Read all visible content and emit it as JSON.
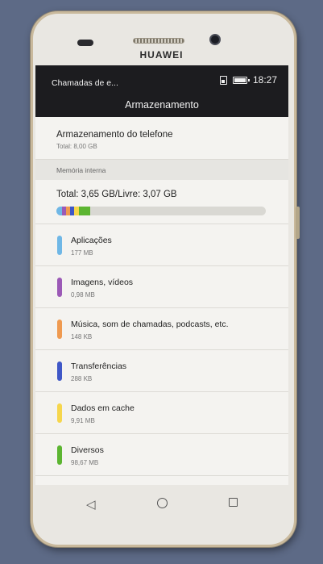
{
  "device": {
    "brand": "HUAWEI"
  },
  "statusbar": {
    "title": "Chamadas de e...",
    "time": "18:27",
    "icons": [
      "sim-icon",
      "battery-icon"
    ]
  },
  "appbar": {
    "title": "Armazenamento"
  },
  "phone_storage": {
    "title": "Armazenamento do telefone",
    "total": "Total: 8,00  GB"
  },
  "internal": {
    "section_label": "Memória interna",
    "total_text": "Total: 3,65 GB/Livre: 3,07 GB",
    "used_fraction": 0.16
  },
  "categories": [
    {
      "label": "Aplicações",
      "size": "177 MB",
      "color": "#6fb7e6"
    },
    {
      "label": "Imagens, vídeos",
      "size": "0,98 MB",
      "color": "#9b59b6"
    },
    {
      "label": "Música, som de chamadas, podcasts, etc.",
      "size": "148 KB",
      "color": "#ef9a50"
    },
    {
      "label": "Transferências",
      "size": "288 KB",
      "color": "#3f57c7"
    },
    {
      "label": "Dados em cache",
      "size": "9,91 MB",
      "color": "#f6d64c"
    },
    {
      "label": "Diversos",
      "size": "98,67 MB",
      "color": "#5cb531"
    }
  ],
  "navbar": {
    "icons": [
      "back-icon",
      "home-icon",
      "recents-icon"
    ]
  }
}
